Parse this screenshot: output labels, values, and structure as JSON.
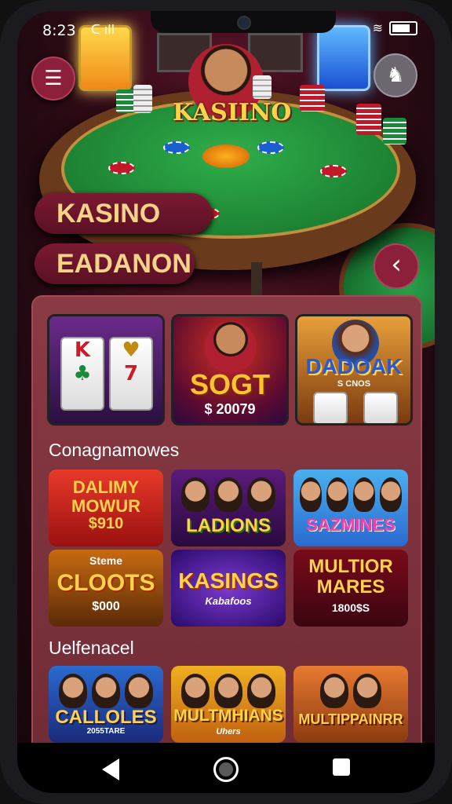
{
  "status": {
    "time": "8:23",
    "left_glyph": "ᑕ ıll",
    "wifi": "≋"
  },
  "header": {
    "logo_text": "KASIINO",
    "menu_icon": "menu-icon",
    "profile_icon": "avatar-icon"
  },
  "hero": {
    "pill1": "KASINO",
    "pill2": "EADANON",
    "back_glyph": "‹"
  },
  "featured": [
    {
      "name": "slot-machine",
      "symbols": [
        "K",
        "7",
        "♣",
        "♥"
      ]
    },
    {
      "title": "SOGT",
      "amount": "$ 20079"
    },
    {
      "title": "DADOAK",
      "subtitle": "S CNOS"
    }
  ],
  "sections": {
    "first_title": "Conagnamowes",
    "second_title": "Uelfenacel"
  },
  "grid1": [
    {
      "line1": "DALIMY",
      "line2": "MOWUR",
      "line3": "$910"
    },
    {
      "line1": "LADIONS"
    },
    {
      "line1": "SAZMINES"
    }
  ],
  "grid2": [
    {
      "line1": "Steme",
      "line2": "CLOOTS",
      "line3": "$000"
    },
    {
      "line1": "KASINGS",
      "line2": "Kabafoos"
    },
    {
      "line1": "MULTIOR",
      "line2": "MARES",
      "line3": "1800$S"
    }
  ],
  "grid3": [
    {
      "line1": "CALLOLES",
      "line2": "2055TARE"
    },
    {
      "line1": "MULTMHIANS",
      "line2": "Uhers"
    },
    {
      "line1": "MULTIPPAINRR"
    }
  ],
  "colors": {
    "accent": "#8c1f3a",
    "gold": "#ffd24a",
    "panel": "#7a323c"
  }
}
